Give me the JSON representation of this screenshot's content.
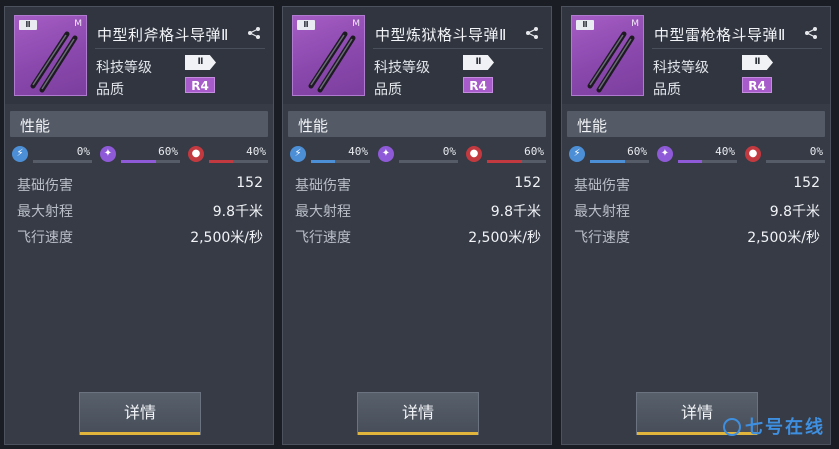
{
  "cards": [
    {
      "title": "中型利斧格斗导弹Ⅱ",
      "tier_tag": "Ⅱ",
      "size_tag": "M",
      "tech_label": "科技等级",
      "tech_value": "Ⅱ",
      "quality_label": "品质",
      "quality_value": "R4",
      "section_title": "性能",
      "damage": [
        {
          "type": "lightning-icon",
          "pct": "0%",
          "fraction": 0.0,
          "color": "#4d8fd6"
        },
        {
          "type": "fire-icon",
          "pct": "60%",
          "fraction": 0.6,
          "color": "#8f5ad8"
        },
        {
          "type": "blood-icon",
          "pct": "40%",
          "fraction": 0.4,
          "color": "#c23a3f"
        }
      ],
      "stats": [
        {
          "label": "基础伤害",
          "value": "152"
        },
        {
          "label": "最大射程",
          "value": "9.8千米"
        },
        {
          "label": "飞行速度",
          "value": "2,500米/秒"
        }
      ],
      "button": "详情"
    },
    {
      "title": "中型炼狱格斗导弹Ⅱ",
      "tier_tag": "Ⅱ",
      "size_tag": "M",
      "tech_label": "科技等级",
      "tech_value": "Ⅱ",
      "quality_label": "品质",
      "quality_value": "R4",
      "section_title": "性能",
      "damage": [
        {
          "type": "lightning-icon",
          "pct": "40%",
          "fraction": 0.4,
          "color": "#4d8fd6"
        },
        {
          "type": "fire-icon",
          "pct": "0%",
          "fraction": 0.0,
          "color": "#8f5ad8"
        },
        {
          "type": "blood-icon",
          "pct": "60%",
          "fraction": 0.6,
          "color": "#c23a3f"
        }
      ],
      "stats": [
        {
          "label": "基础伤害",
          "value": "152"
        },
        {
          "label": "最大射程",
          "value": "9.8千米"
        },
        {
          "label": "飞行速度",
          "value": "2,500米/秒"
        }
      ],
      "button": "详情"
    },
    {
      "title": "中型雷枪格斗导弹Ⅱ",
      "tier_tag": "Ⅱ",
      "size_tag": "M",
      "tech_label": "科技等级",
      "tech_value": "Ⅱ",
      "quality_label": "品质",
      "quality_value": "R4",
      "section_title": "性能",
      "damage": [
        {
          "type": "lightning-icon",
          "pct": "60%",
          "fraction": 0.6,
          "color": "#4d8fd6"
        },
        {
          "type": "fire-icon",
          "pct": "40%",
          "fraction": 0.4,
          "color": "#8f5ad8"
        },
        {
          "type": "blood-icon",
          "pct": "0%",
          "fraction": 0.0,
          "color": "#c23a3f"
        }
      ],
      "stats": [
        {
          "label": "基础伤害",
          "value": "152"
        },
        {
          "label": "最大射程",
          "value": "9.8千米"
        },
        {
          "label": "飞行速度",
          "value": "2,500米/秒"
        }
      ],
      "button": "详情"
    }
  ],
  "watermark": "七号在线"
}
